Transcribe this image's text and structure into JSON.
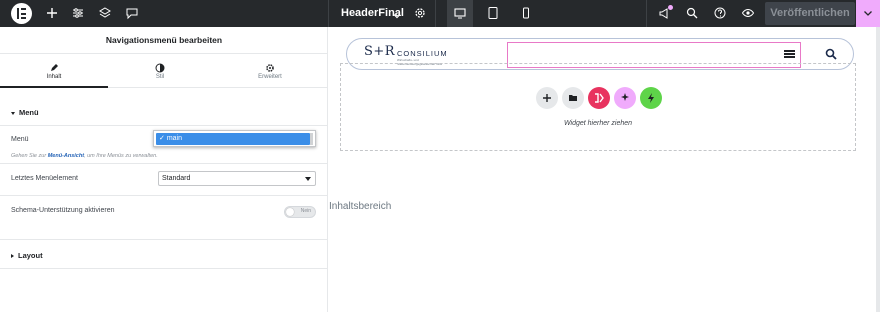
{
  "topbar": {
    "document_title": "HeaderFinal",
    "publish_label": "Veröffentlichen",
    "accent_color": "#f0abfc",
    "icons": [
      "elementor-logo-icon",
      "add-icon",
      "settings-sliders-icon",
      "layers-icon",
      "comments-icon",
      "chevron-down-icon",
      "gear-icon",
      "desktop-icon",
      "tablet-icon",
      "mobile-icon",
      "megaphone-icon",
      "search-icon",
      "help-icon",
      "eye-icon",
      "chevron-down-icon"
    ]
  },
  "panel": {
    "title": "Navigationsmenü bearbeiten",
    "tabs": [
      {
        "label": "Inhalt",
        "icon": "pencil-icon"
      },
      {
        "label": "Stil",
        "icon": "contrast-icon"
      },
      {
        "label": "Erweitert",
        "icon": "gear-icon"
      }
    ],
    "section_menu": "Menü",
    "menu_label": "Menü",
    "menu_selected": "main",
    "hint_prefix": "Gehen Sie zur ",
    "hint_link": "Menü-Ansicht",
    "hint_suffix": ", um Ihre Menüs zu verwalten.",
    "last_item_label": "Letztes Menüelement",
    "last_item_value": "Standard",
    "schema_label": "Schema-Unterstützung aktivieren",
    "schema_toggle": "Nein",
    "section_layout": "Layout"
  },
  "preview": {
    "brand_mark": "S+R",
    "brand_name": "CONSILIUM",
    "brand_sub": "Wirtschafts- und Steuerberatungsgesellschaft mbH",
    "drop_text": "Widget hierher ziehen",
    "content_label": "Inhaltsbereich",
    "add_buttons": [
      {
        "icon": "plus-icon",
        "color": "#e6e8ea"
      },
      {
        "icon": "folder-icon",
        "color": "#e6e8ea"
      },
      {
        "icon": "elementor-kit-icon",
        "color": "#e8335f"
      },
      {
        "icon": "ai-sparkle-icon",
        "color": "#f0abfc"
      },
      {
        "icon": "lightning-icon",
        "color": "#5ed449"
      }
    ]
  }
}
